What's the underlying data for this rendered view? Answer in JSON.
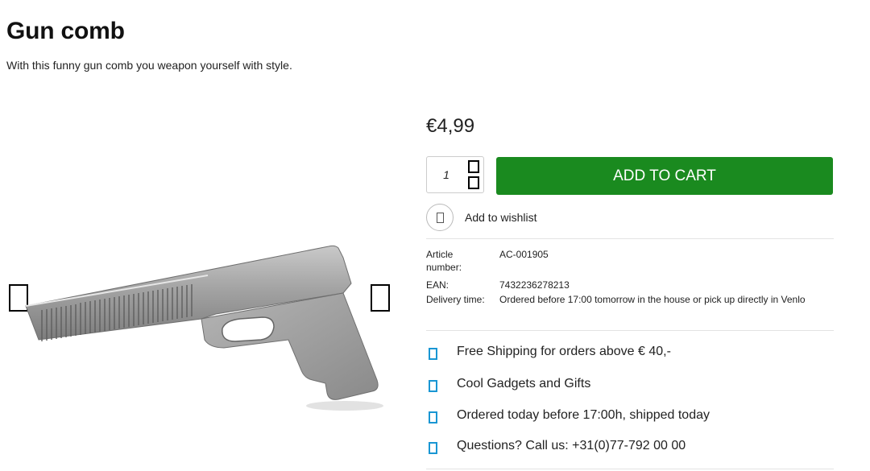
{
  "product": {
    "title": "Gun comb",
    "description": "With this funny gun comb you weapon yourself with style.",
    "price": "€4,99"
  },
  "purchase": {
    "quantity": "1",
    "add_to_cart_label": "ADD TO CART",
    "wishlist_label": "Add to wishlist",
    "accent_color": "#1a8a1f"
  },
  "specs": [
    {
      "label": "Article number:",
      "value": "AC-001905"
    },
    {
      "label": "EAN:",
      "value": "7432236278213"
    },
    {
      "label": "Delivery time:",
      "value": "Ordered before 17:00 tomorrow in the house or pick up directly in Venlo"
    }
  ],
  "usps": [
    {
      "text": "Free Shipping for orders above € 40,-",
      "icon": "check-icon"
    },
    {
      "text": "Cool Gadgets and Gifts",
      "icon": "gift-icon"
    },
    {
      "text": "Ordered today before 17:00h, shipped today",
      "icon": "truck-icon"
    },
    {
      "text": "Questions? Call us: +31(0)77-792 00 00",
      "icon": "phone-icon"
    }
  ],
  "icon_color": "#1996d3"
}
